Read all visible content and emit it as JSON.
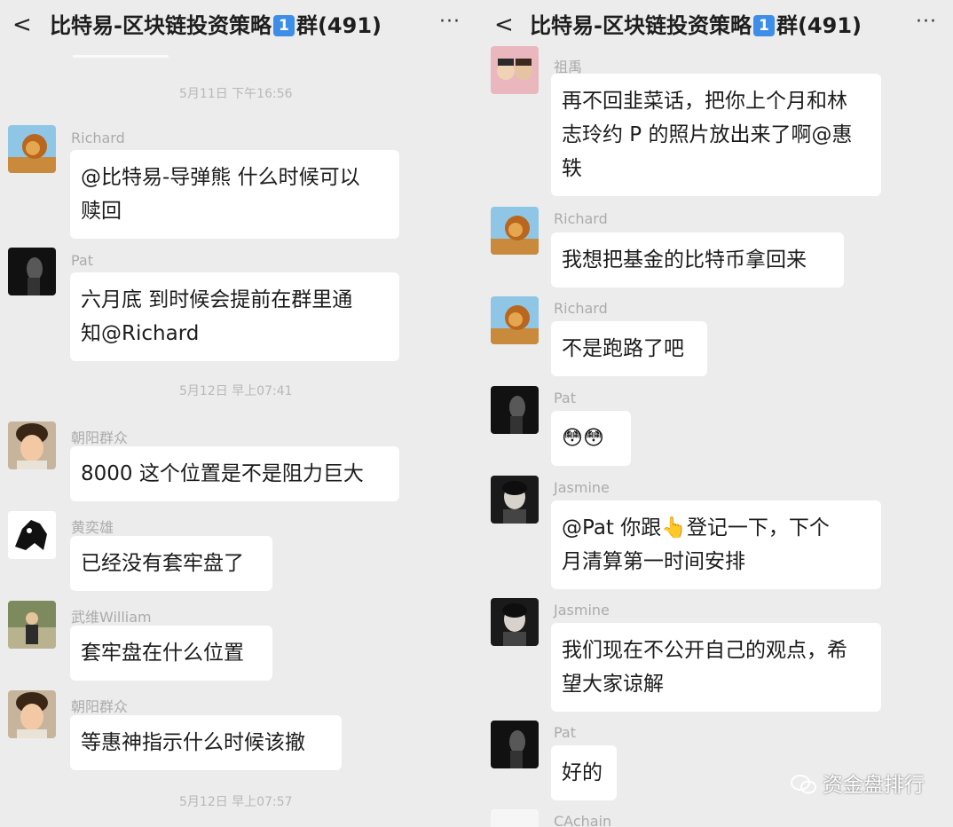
{
  "left": {
    "title_prefix": "比特易-区块链投资策略",
    "title_badge": "1",
    "title_suffix": "群(491)",
    "back_glyph": "<",
    "more_glyph": "···",
    "times": [
      "5月11日 下午16:56",
      "5月12日 早上07:41",
      "5月12日 早上07:57"
    ],
    "messages": [
      {
        "name": "Richard",
        "text_lines": [
          "@比特易-导弹熊  什么时候可以",
          "赎回"
        ]
      },
      {
        "name": "Pat",
        "text_lines": [
          "六月底 到时候会提前在群里通",
          "知@Richard"
        ]
      },
      {
        "name": "朝阳群众",
        "text_lines": [
          "8000 这个位置是不是阻力巨大"
        ]
      },
      {
        "name": "黄奕雄",
        "text_lines": [
          "已经没有套牢盘了"
        ]
      },
      {
        "name": "武维William",
        "text_lines": [
          "套牢盘在什么位置"
        ]
      },
      {
        "name": "朝阳群众",
        "text_lines": [
          "等惠神指示什么时候该撤"
        ]
      }
    ]
  },
  "right": {
    "title_prefix": "比特易-区块链投资策略",
    "title_badge": "1",
    "title_suffix": "群(491)",
    "back_glyph": "<",
    "more_glyph": "···",
    "messages": [
      {
        "name": "祖禹",
        "text_lines": [
          "再不回韭菜话，把你上个月和林",
          "志玲约 P 的照片放出来了啊@惠",
          "轶"
        ]
      },
      {
        "name": "Richard",
        "text_lines": [
          "我想把基金的比特币拿回来"
        ]
      },
      {
        "name": "Richard",
        "text_lines": [
          "不是跑路了吧"
        ]
      },
      {
        "name": "Pat",
        "text_lines": [
          "😳😳"
        ]
      },
      {
        "name": "Jasmine",
        "text_lines": [
          "@Pat  你跟👆登记一下，下个",
          "月清算第一时间安排"
        ]
      },
      {
        "name": "Jasmine",
        "text_lines": [
          "我们现在不公开自己的观点，希",
          "望大家谅解"
        ]
      },
      {
        "name": "Pat",
        "text_lines": [
          "好的"
        ]
      },
      {
        "name": "CAchain",
        "text_lines": []
      }
    ]
  },
  "watermark": {
    "text": "资金盘排行"
  },
  "colors": {
    "background": "#ececec",
    "bubble": "#ffffff",
    "badge": "#3e8ee9",
    "meta_text": "#ababab"
  }
}
